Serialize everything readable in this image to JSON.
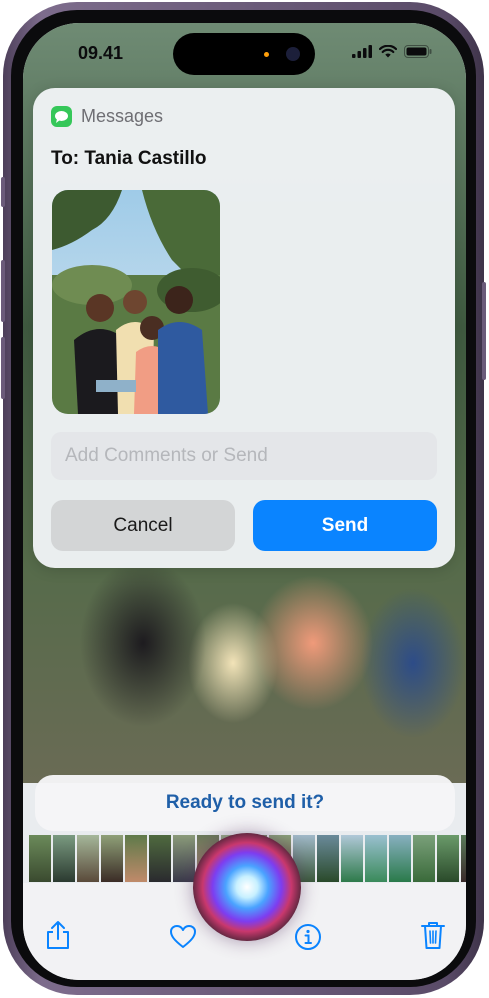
{
  "status_bar": {
    "time": "09.41"
  },
  "message_card": {
    "app_name": "Messages",
    "recipient_line": "To: Tania Castillo",
    "comment_placeholder": "Add Comments or Send",
    "cancel_label": "Cancel",
    "send_label": "Send"
  },
  "siri_suggestion": "Ready to send it?",
  "toolbar": {
    "icons": [
      "share-icon",
      "heart-icon",
      "siri-orb",
      "info-icon",
      "trash-icon"
    ]
  },
  "colors": {
    "accent": "#0a84ff",
    "messages_green": "#35c759",
    "suggestion_text": "#1f5fa8"
  }
}
